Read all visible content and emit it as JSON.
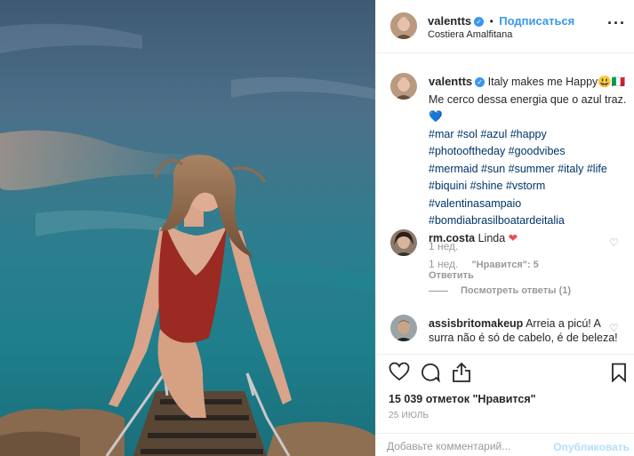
{
  "post": {
    "username": "valentts",
    "follow_label": "Подписаться",
    "follow_sep": "•",
    "location": "Costiera Amalfitana",
    "more_label": "···"
  },
  "caption": {
    "username": "valentts",
    "text": "Italy makes me Happy😃🇮🇹 Me cerco dessa energia que o azul traz. 💙",
    "hashtags": [
      "#mar #sol #azul #happy",
      "#photooftheday #goodvibes",
      "#mermaid #sun #summer #italy #life",
      "#biquini #shine #vstorm",
      "#valentinasampaio",
      "#bomdiabrasilboatardeitalia"
    ],
    "time": "1 нед."
  },
  "comments": [
    {
      "username": "rm.costa",
      "text": "Linda",
      "emoji": "❤",
      "time": "1 нед.",
      "likes": "\"Нравится\": 5",
      "reply_label": "Ответить",
      "view_replies": "Посмотреть ответы (1)"
    },
    {
      "username": "assisbritomakeup",
      "text": "Arreia a picú! A surra não é só de cabelo, é de beleza!"
    }
  ],
  "likes_text": "15 039 отметок \"Нравится\"",
  "date": "25 июль",
  "add_comment": {
    "placeholder": "Добавьте комментарий...",
    "publish_label": "Опубликовать"
  },
  "colors": {
    "accent": "#3897f0",
    "hashtag": "#003569",
    "heart": "#ed4956"
  }
}
